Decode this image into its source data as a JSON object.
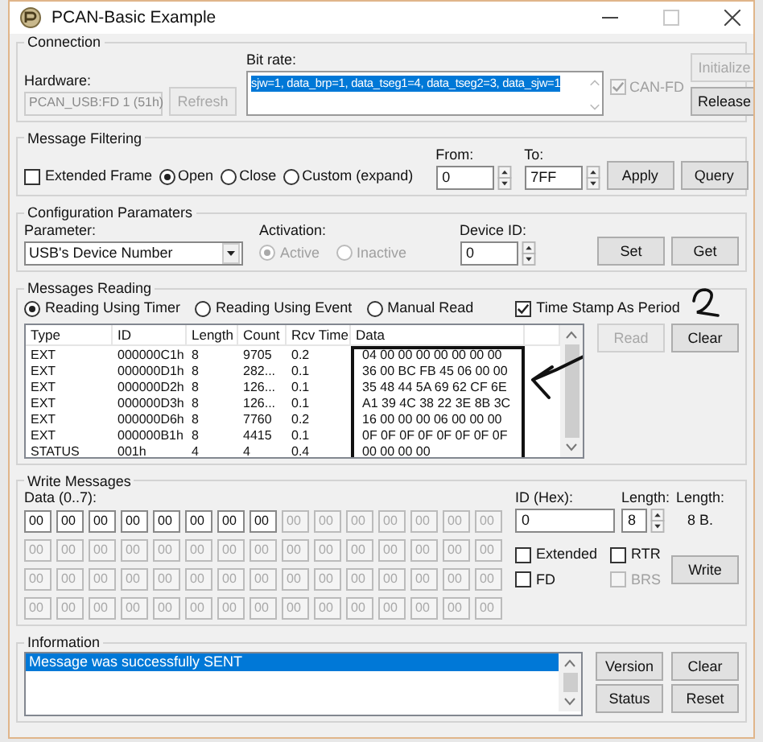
{
  "window": {
    "title": "PCAN-Basic Example"
  },
  "connection": {
    "title": "Connection",
    "hardware_label": "Hardware:",
    "hardware_value": "PCAN_USB:FD 1 (51h)",
    "hardware_disabled": true,
    "refresh": {
      "label": "Refresh",
      "disabled": true
    },
    "bitrate_label": "Bit rate:",
    "bitrate_value": "sjw=1, data_brp=1, data_tseg1=4, data_tseg2=3, data_sjw=1",
    "bitrate_selected": true,
    "canfd": {
      "label": "CAN-FD",
      "checked": true,
      "disabled": true
    },
    "initialize": {
      "label": "Initialize",
      "disabled": true
    },
    "release": {
      "label": "Release",
      "disabled": false
    }
  },
  "filtering": {
    "title": "Message Filtering",
    "extended": {
      "label": "Extended Frame",
      "checked": false,
      "disabled": false
    },
    "modes": [
      {
        "label": "Open",
        "selected": true
      },
      {
        "label": "Close",
        "selected": false
      },
      {
        "label": "Custom (expand)",
        "selected": false
      }
    ],
    "from_label": "From:",
    "from_value": "0",
    "to_label": "To:",
    "to_value": "7FF",
    "apply": {
      "label": "Apply",
      "disabled": false
    },
    "query": {
      "label": "Query",
      "disabled": false
    }
  },
  "config": {
    "title": "Configuration Paramaters",
    "parameter_label": "Parameter:",
    "parameter_value": "USB's Device Number",
    "activation_label": "Activation:",
    "activation": [
      {
        "label": "Active",
        "selected": true,
        "disabled": true
      },
      {
        "label": "Inactive",
        "selected": false,
        "disabled": true
      }
    ],
    "device_label": "Device ID:",
    "device_value": "0",
    "set": {
      "label": "Set",
      "disabled": false
    },
    "get": {
      "label": "Get",
      "disabled": false
    }
  },
  "reading": {
    "title": "Messages Reading",
    "modes": [
      {
        "label": "Reading Using Timer",
        "selected": true
      },
      {
        "label": "Reading Using Event",
        "selected": false
      },
      {
        "label": "Manual Read",
        "selected": false
      }
    ],
    "timestamp": {
      "label": "Time Stamp As Period",
      "checked": true,
      "disabled": false
    },
    "columns": [
      "Type",
      "ID",
      "Length",
      "Count",
      "Rcv Time",
      "Data"
    ],
    "rows": [
      {
        "cells": [
          "EXT",
          "000000C1h",
          "8",
          "9705",
          "0.2",
          "04 00 00 00 00 00 00 00"
        ]
      },
      {
        "cells": [
          "EXT",
          "000000D1h",
          "8",
          "282...",
          "0.1",
          "36 00 BC FB 45 06 00 00"
        ]
      },
      {
        "cells": [
          "EXT",
          "000000D2h",
          "8",
          "126...",
          "0.1",
          "35 48 44 5A 69 62 CF 6E"
        ]
      },
      {
        "cells": [
          "EXT",
          "000000D3h",
          "8",
          "126...",
          "0.1",
          "A1 39 4C 38 22 3E 8B 3C"
        ]
      },
      {
        "cells": [
          "EXT",
          "000000D6h",
          "8",
          "7760",
          "0.2",
          "16 00 00 00 06 00 00 00"
        ]
      },
      {
        "cells": [
          "EXT",
          "000000B1h",
          "8",
          "4415",
          "0.1",
          "0F 0F 0F 0F 0F 0F 0F 0F"
        ]
      },
      {
        "cells": [
          "STATUS",
          "001h",
          "4",
          "4",
          "0.4",
          "00 00 00 00"
        ]
      }
    ],
    "read": {
      "label": "Read",
      "disabled": true
    },
    "clear": {
      "label": "Clear",
      "disabled": false
    }
  },
  "write": {
    "title": "Write Messages",
    "data_label": "Data (0..7):",
    "data": [
      [
        {
          "value": "00",
          "disabled": false
        },
        {
          "value": "00",
          "disabled": false
        },
        {
          "value": "00",
          "disabled": false
        },
        {
          "value": "00",
          "disabled": false
        },
        {
          "value": "00",
          "disabled": false
        },
        {
          "value": "00",
          "disabled": false
        },
        {
          "value": "00",
          "disabled": false
        },
        {
          "value": "00",
          "disabled": false
        },
        {
          "value": "00",
          "disabled": true
        },
        {
          "value": "00",
          "disabled": true
        },
        {
          "value": "00",
          "disabled": true
        },
        {
          "value": "00",
          "disabled": true
        },
        {
          "value": "00",
          "disabled": true
        },
        {
          "value": "00",
          "disabled": true
        },
        {
          "value": "00",
          "disabled": true
        }
      ],
      [
        {
          "value": "00",
          "disabled": true
        },
        {
          "value": "00",
          "disabled": true
        },
        {
          "value": "00",
          "disabled": true
        },
        {
          "value": "00",
          "disabled": true
        },
        {
          "value": "00",
          "disabled": true
        },
        {
          "value": "00",
          "disabled": true
        },
        {
          "value": "00",
          "disabled": true
        },
        {
          "value": "00",
          "disabled": true
        },
        {
          "value": "00",
          "disabled": true
        },
        {
          "value": "00",
          "disabled": true
        },
        {
          "value": "00",
          "disabled": true
        },
        {
          "value": "00",
          "disabled": true
        },
        {
          "value": "00",
          "disabled": true
        },
        {
          "value": "00",
          "disabled": true
        },
        {
          "value": "00",
          "disabled": true
        }
      ],
      [
        {
          "value": "00",
          "disabled": true
        },
        {
          "value": "00",
          "disabled": true
        },
        {
          "value": "00",
          "disabled": true
        },
        {
          "value": "00",
          "disabled": true
        },
        {
          "value": "00",
          "disabled": true
        },
        {
          "value": "00",
          "disabled": true
        },
        {
          "value": "00",
          "disabled": true
        },
        {
          "value": "00",
          "disabled": true
        },
        {
          "value": "00",
          "disabled": true
        },
        {
          "value": "00",
          "disabled": true
        },
        {
          "value": "00",
          "disabled": true
        },
        {
          "value": "00",
          "disabled": true
        },
        {
          "value": "00",
          "disabled": true
        },
        {
          "value": "00",
          "disabled": true
        },
        {
          "value": "00",
          "disabled": true
        }
      ],
      [
        {
          "value": "00",
          "disabled": true
        },
        {
          "value": "00",
          "disabled": true
        },
        {
          "value": "00",
          "disabled": true
        },
        {
          "value": "00",
          "disabled": true
        },
        {
          "value": "00",
          "disabled": true
        },
        {
          "value": "00",
          "disabled": true
        },
        {
          "value": "00",
          "disabled": true
        },
        {
          "value": "00",
          "disabled": true
        },
        {
          "value": "00",
          "disabled": true
        },
        {
          "value": "00",
          "disabled": true
        },
        {
          "value": "00",
          "disabled": true
        },
        {
          "value": "00",
          "disabled": true
        },
        {
          "value": "00",
          "disabled": true
        },
        {
          "value": "00",
          "disabled": true
        },
        {
          "value": "00",
          "disabled": true
        }
      ]
    ],
    "id_label": "ID (Hex):",
    "id_value": "0",
    "length_label": "Length:",
    "length_value": "8",
    "length2_label": "Length:",
    "length2_value": "8 B.",
    "checks": [
      {
        "label": "Extended",
        "checked": false,
        "disabled": false
      },
      {
        "label": "RTR",
        "checked": false,
        "disabled": false
      },
      {
        "label": "FD",
        "checked": false,
        "disabled": false
      },
      {
        "label": "BRS",
        "checked": false,
        "disabled": true
      }
    ],
    "write": {
      "label": "Write",
      "disabled": false
    }
  },
  "information": {
    "title": "Information",
    "messages": [
      {
        "text": "Message was successfully SENT",
        "selected": true
      }
    ],
    "version": {
      "label": "Version",
      "disabled": false
    },
    "clear": {
      "label": "Clear",
      "disabled": false
    },
    "status": {
      "label": "Status",
      "disabled": false
    },
    "reset": {
      "label": "Reset",
      "disabled": false
    }
  }
}
